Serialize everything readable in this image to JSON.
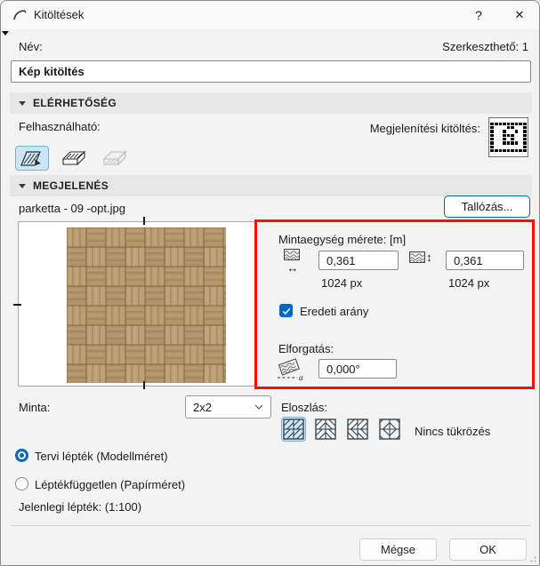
{
  "window": {
    "title": "Kitöltések",
    "help_label": "?",
    "close_label": "✕"
  },
  "name_row": {
    "label": "Név:",
    "editable_label": "Szerkeszthető: 1",
    "value": "Kép kitöltés"
  },
  "availability": {
    "title": "ELÉRHETŐSÉG",
    "usable_label": "Felhasználható:",
    "display_fill_label": "Megjelenítési kitöltés:",
    "buttons": [
      {
        "icon": "drafting-fill-icon",
        "selected": true,
        "disabled": false
      },
      {
        "icon": "cover-fill-icon",
        "selected": false,
        "disabled": false
      },
      {
        "icon": "cut-fill-icon",
        "selected": false,
        "disabled": true
      }
    ]
  },
  "appearance": {
    "title": "MEGJELENÉS",
    "filename": "parketta - 09 -opt.jpg",
    "browse_label": "Tallózás...",
    "unit_size_label": "Mintaegység mérete: [m]",
    "width_value": "0,361",
    "height_value": "0,361",
    "width_px": "1024 px",
    "height_px": "1024 px",
    "keep_ratio_label": "Eredeti arány",
    "keep_ratio_checked": true,
    "rotation_label": "Elforgatás:",
    "rotation_value": "0,000°"
  },
  "sample": {
    "label": "Minta:",
    "value": "2x2"
  },
  "distribution": {
    "label": "Eloszlás:",
    "mirror_label": "Nincs tükrözés",
    "options": [
      {
        "icon": "mirror-none-icon",
        "selected": true
      },
      {
        "icon": "mirror-x-icon",
        "selected": false
      },
      {
        "icon": "mirror-y-icon",
        "selected": false
      },
      {
        "icon": "mirror-xy-icon",
        "selected": false
      }
    ]
  },
  "scale_options": [
    {
      "label": "Tervi lépték (Modellméret)",
      "selected": true
    },
    {
      "label": "Léptékfüggetlen (Papírméret)",
      "selected": false
    }
  ],
  "current_scale": "Jelenlegi lépték: (1:100)",
  "footer": {
    "cancel_label": "Mégse",
    "ok_label": "OK"
  },
  "display_fill": {
    "pattern_grid": [
      "111111111",
      "100011001",
      "100100101",
      "100111001",
      "100101001",
      "100111101",
      "100000001",
      "111111111"
    ]
  },
  "colors": {
    "accent": "#0067c0",
    "selected_bg": "#cde6f7",
    "selected_border": "#7ab1d8",
    "highlight_red": "#fb0d00",
    "texture_base": "#b79a6d",
    "texture_groove": "#8a6c44"
  }
}
